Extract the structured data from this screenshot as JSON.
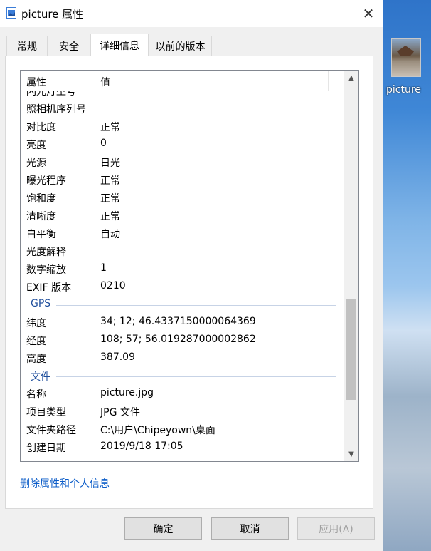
{
  "window": {
    "title": "picture 属性",
    "close_glyph": "✕"
  },
  "tabs": [
    {
      "label": "常规",
      "active": false
    },
    {
      "label": "安全",
      "active": false
    },
    {
      "label": "详细信息",
      "active": true
    },
    {
      "label": "以前的版本",
      "active": false
    }
  ],
  "list": {
    "headers": {
      "property": "属性",
      "value": "值"
    },
    "rows": [
      {
        "type": "item",
        "name": "闪光灯型号",
        "value": ""
      },
      {
        "type": "item",
        "name": "照相机序列号",
        "value": ""
      },
      {
        "type": "item",
        "name": "对比度",
        "value": "正常"
      },
      {
        "type": "item",
        "name": "亮度",
        "value": "0"
      },
      {
        "type": "item",
        "name": "光源",
        "value": "日光"
      },
      {
        "type": "item",
        "name": "曝光程序",
        "value": "正常"
      },
      {
        "type": "item",
        "name": "饱和度",
        "value": "正常"
      },
      {
        "type": "item",
        "name": "清晰度",
        "value": "正常"
      },
      {
        "type": "item",
        "name": "白平衡",
        "value": "自动"
      },
      {
        "type": "item",
        "name": "光度解释",
        "value": ""
      },
      {
        "type": "item",
        "name": "数字缩放",
        "value": "1"
      },
      {
        "type": "item",
        "name": "EXIF 版本",
        "value": "0210"
      },
      {
        "type": "group",
        "name": "GPS"
      },
      {
        "type": "item",
        "name": "纬度",
        "value": "34; 12; 46.4337150000064369"
      },
      {
        "type": "item",
        "name": "经度",
        "value": "108; 57; 56.019287000002862"
      },
      {
        "type": "item",
        "name": "高度",
        "value": "387.09"
      },
      {
        "type": "group",
        "name": "文件"
      },
      {
        "type": "item",
        "name": "名称",
        "value": "picture.jpg"
      },
      {
        "type": "item",
        "name": "项目类型",
        "value": "JPG 文件"
      },
      {
        "type": "item",
        "name": "文件夹路径",
        "value": "C:\\用户\\Chipeyown\\桌面"
      },
      {
        "type": "item",
        "name": "创建日期",
        "value": "2019/9/18 17:05"
      }
    ]
  },
  "remove_link": "删除属性和个人信息",
  "buttons": {
    "ok": "确定",
    "cancel": "取消",
    "apply": "应用(A)"
  },
  "desktop": {
    "icon_label": "picture"
  },
  "colors": {
    "link": "#0b5cc8",
    "group_header": "#1f4e9c"
  }
}
